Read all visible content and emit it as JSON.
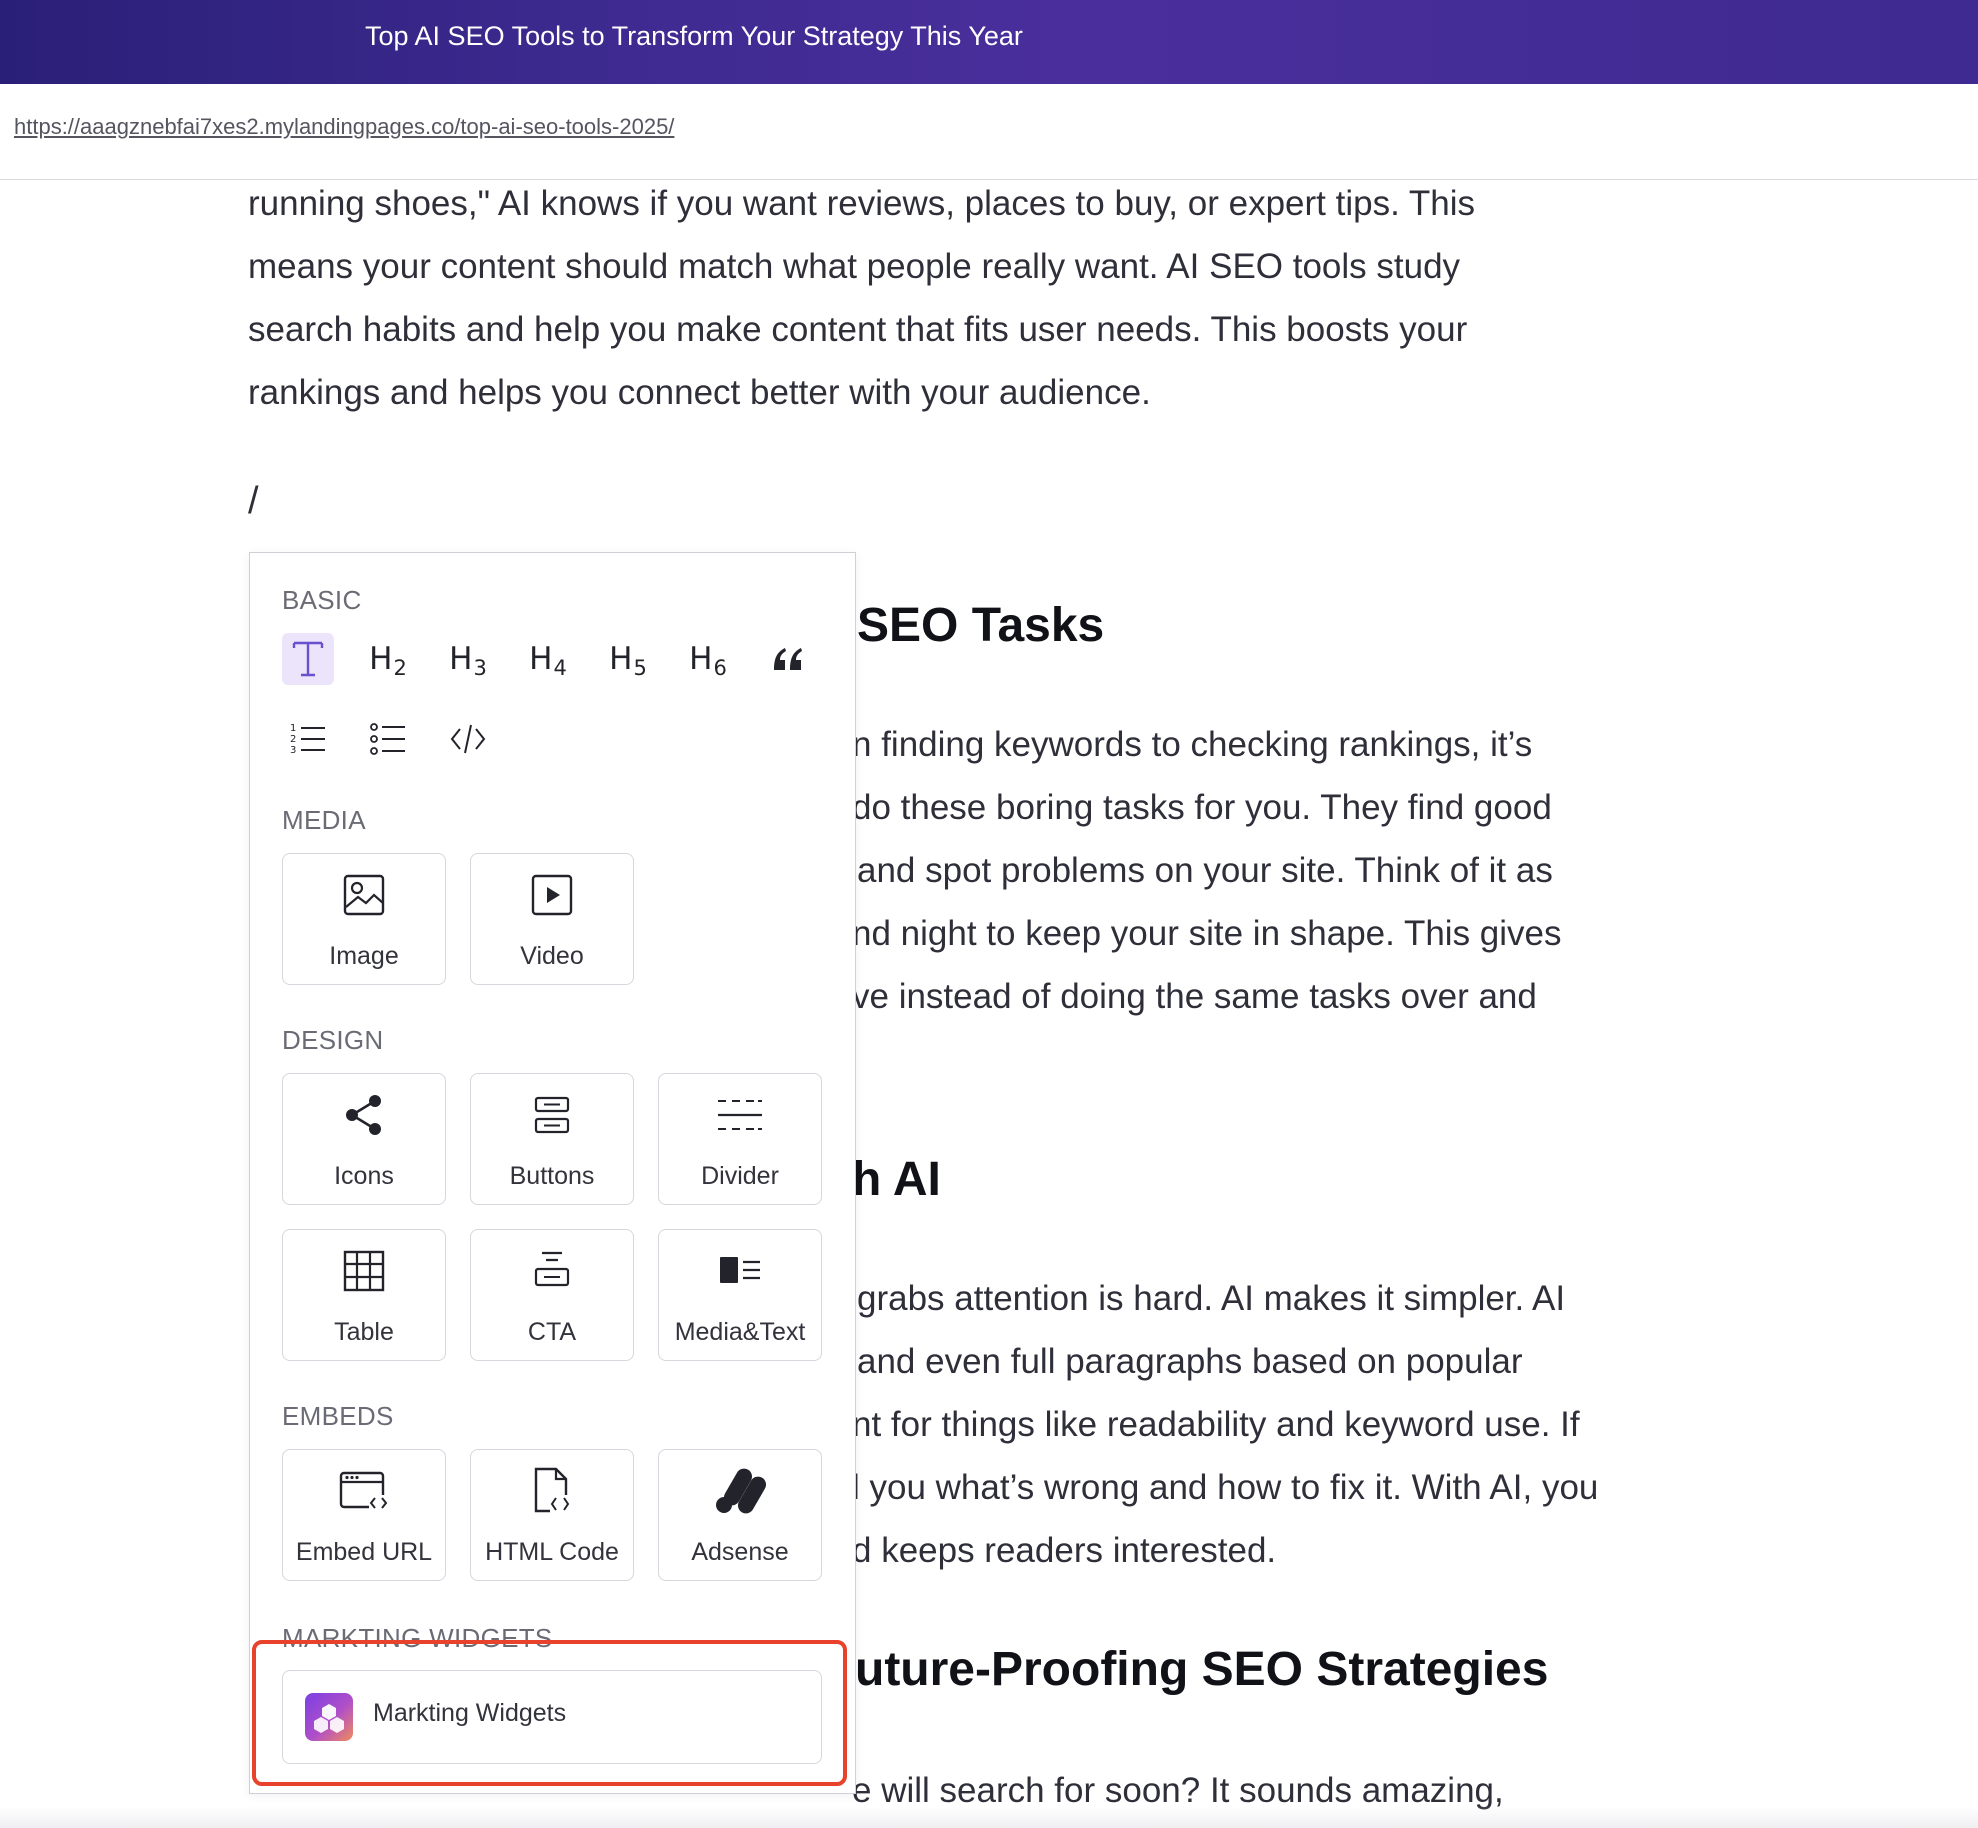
{
  "header": {
    "title": "Top AI SEO Tools to Transform Your Strategy This Year"
  },
  "address_bar": {
    "url": "https://aaagznebfai7xes2.mylandingpages.co/top-ai-seo-tools-2025/"
  },
  "article": {
    "intro_lines": [
      "running shoes,\" AI knows if you want reviews, places to buy, or expert tips. This",
      "means your content should match what people really want. AI SEO tools study",
      "search habits and help you make content that fits user needs. This boosts your",
      "rankings and helps you connect better with your audience."
    ],
    "slash_input": "/",
    "heading_1": "SEO Tasks",
    "section_1_lines": [
      "n finding keywords to checking rankings, it’s",
      " do these boring tasks for you. They find good",
      "and spot problems on your site. Think of it as",
      "nd night to keep your site in shape. This gives",
      "ve instead of doing the same tasks over and"
    ],
    "heading_2": "h AI",
    "section_2_lines": [
      "grabs attention is hard. AI makes it simpler. AI",
      "and even full paragraphs based on popular",
      "nt for things like readability and keyword use. If",
      "l you what’s wrong and how to fix it. With AI, you",
      "d keeps readers interested."
    ],
    "heading_3": "uture-Proofing SEO Strategies",
    "section_3_line": "e will search for soon? It sounds amazing,"
  },
  "block_menu": {
    "basic": {
      "label": "BASIC",
      "headings": [
        "H2",
        "H3",
        "H4",
        "H5",
        "H6"
      ]
    },
    "media": {
      "label": "MEDIA",
      "items": [
        "Image",
        "Video"
      ]
    },
    "design": {
      "label": "DESIGN",
      "items": [
        "Icons",
        "Buttons",
        "Divider",
        "Table",
        "CTA",
        "Media&Text"
      ]
    },
    "embeds": {
      "label": "EMBEDS",
      "items": [
        "Embed URL",
        "HTML Code",
        "Adsense"
      ]
    },
    "marketing": {
      "label": "MARKTING WIDGETS",
      "item": "Markting Widgets"
    }
  },
  "colors": {
    "header_start": "#2a1f78",
    "header_end": "#4a2f9c",
    "active_tool_bg": "#ebe4fb",
    "highlight_border": "#e8412c"
  }
}
